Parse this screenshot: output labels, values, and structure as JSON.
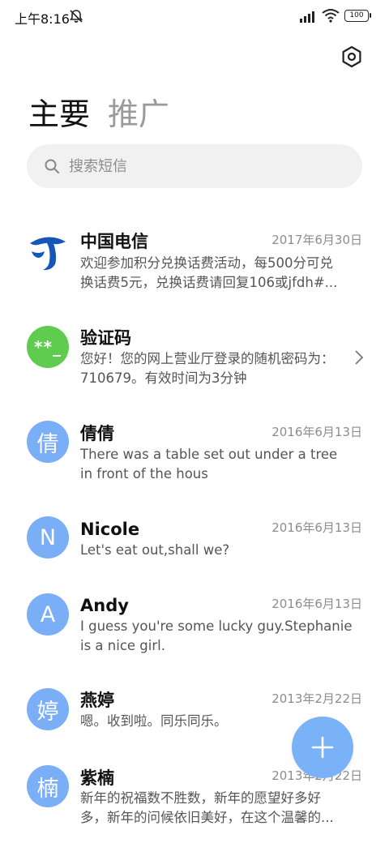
{
  "status": {
    "time": "上午8:16",
    "battery": "100"
  },
  "tabs": [
    {
      "label": "主要",
      "active": true
    },
    {
      "label": "推广",
      "active": false
    }
  ],
  "search": {
    "placeholder": "搜索短信"
  },
  "messages": [
    {
      "name": "中国电信",
      "date": "2017年6月30日",
      "preview": [
        "欢迎参加积分兑换话费活动，每500分可兑",
        "换话费5元，兑换话费请回复106或jfdh#..."
      ],
      "avatar": "",
      "avatar_type": "telecom-logo"
    },
    {
      "name": "验证码",
      "date": "",
      "preview": [
        "您好！您的网上营业厅登录的随机密码为：",
        "710679。有效时间为3分钟"
      ],
      "avatar": "**_",
      "avatar_type": "green"
    },
    {
      "name": "倩倩",
      "date": "2016年6月13日",
      "preview": [
        "There was a table set out under a tree",
        "in front of the hous"
      ],
      "avatar": "倩",
      "avatar_type": "blue"
    },
    {
      "name": "Nicole",
      "date": "2016年6月13日",
      "preview": [
        "Let's eat out,shall we?"
      ],
      "avatar": "N",
      "avatar_type": "blue"
    },
    {
      "name": "Andy",
      "date": "2016年6月13日",
      "preview": [
        "I guess you're some lucky guy.Stephanie",
        "is a nice girl."
      ],
      "avatar": "A",
      "avatar_type": "blue"
    },
    {
      "name": "燕婷",
      "date": "2013年2月22日",
      "preview": [
        "嗯。收到啦。同乐同乐。"
      ],
      "avatar": "婷",
      "avatar_type": "blue"
    },
    {
      "name": "紫楠",
      "date": "2013年2月22日",
      "preview": [
        "新年的祝福数不胜数，新年的愿望好多好",
        "多，新年的问候依旧美好，在这个温馨的..."
      ],
      "avatar": "楠",
      "avatar_type": "blue"
    }
  ],
  "colors": {
    "accent": "#7ab2f8",
    "avatar_blue": "#7aaef7",
    "avatar_green": "#5fcc50",
    "telecom_blue": "#1556b8"
  },
  "icons": {
    "settings": "gear-icon",
    "search": "search-icon",
    "compose": "plus-icon",
    "chevron": "chevron-right-icon"
  }
}
